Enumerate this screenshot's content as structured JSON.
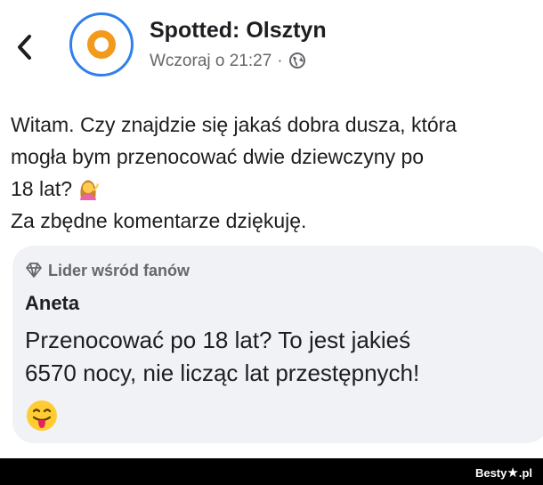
{
  "header": {
    "back_icon": "chevron-left-icon",
    "page_name": "Spotted: Olsztyn",
    "timestamp": "Wczoraj o 21:27",
    "separator": "·",
    "privacy_icon": "globe-icon",
    "avatar_colors": {
      "ring": "#2f80ed",
      "inner": "#f39a1e"
    }
  },
  "post": {
    "lines": [
      "Witam. Czy znajdzie się jakaś dobra dusza, która",
      "mogła bym przenocować dwie dziewczyny po",
      "18 lat?",
      "Za zbędne komentarze dziękuję."
    ],
    "emoji": "woman-tipping-hand-emoji"
  },
  "comment": {
    "badge_icon": "diamond-icon",
    "badge": "Lider wśród fanów",
    "author": "Aneta",
    "lines": [
      "Przenocować po 18 lat? To jest jakieś",
      "6570 nocy, nie licząc lat przestępnych!"
    ],
    "emoji": "face-with-tongue-emoji",
    "background": "#f0f2f5"
  },
  "footer": {
    "logo": "Besty",
    "logo_suffix": ".pl",
    "logo_icon": "star-icon"
  }
}
